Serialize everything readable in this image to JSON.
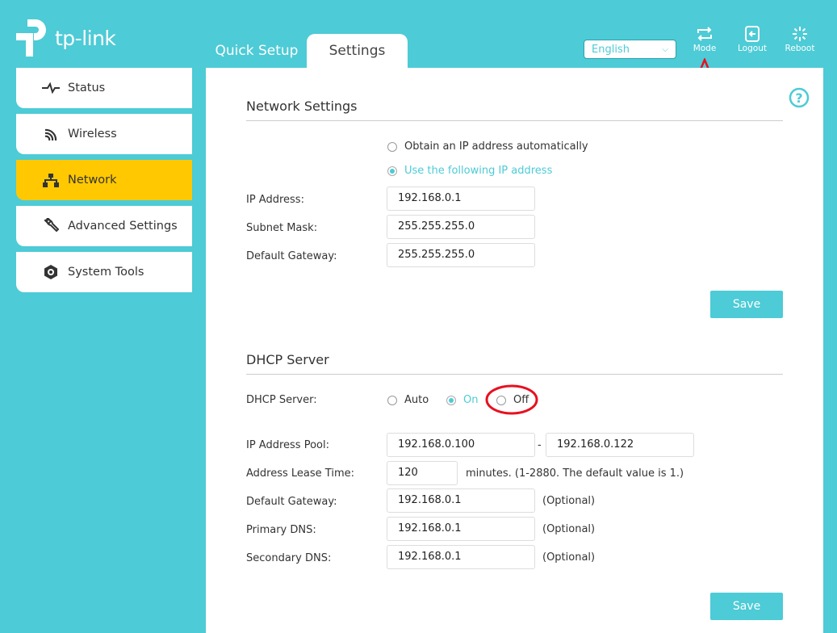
{
  "brand": {
    "name": "tp-link"
  },
  "tabs": [
    {
      "label": "Quick Setup"
    },
    {
      "label": "Settings",
      "active": true
    }
  ],
  "header": {
    "language": "English",
    "buttons": [
      {
        "label": "Mode",
        "icon": "mode-switch-icon"
      },
      {
        "label": "Logout",
        "icon": "logout-icon"
      },
      {
        "label": "Reboot",
        "icon": "reboot-icon"
      }
    ]
  },
  "sidebar": {
    "items": [
      {
        "label": "Status",
        "icon": "pulse-icon"
      },
      {
        "label": "Wireless",
        "icon": "wifi-icon"
      },
      {
        "label": "Network",
        "icon": "network-icon",
        "active": true
      },
      {
        "label": "Advanced Settings",
        "icon": "wrench-icon"
      },
      {
        "label": "System Tools",
        "icon": "gear-icon"
      }
    ]
  },
  "colors": {
    "accent": "#4dcbd6",
    "active_nav": "#ffc800",
    "annotation": "#e8101f"
  },
  "network": {
    "title": "Network Settings",
    "opt_auto": "Obtain an IP address automatically",
    "opt_manual": "Use the following IP address",
    "selected": "Use the following IP address",
    "fields": [
      {
        "label": "IP Address:",
        "value": "192.168.0.1"
      },
      {
        "label": "Subnet Mask:",
        "value": "255.255.255.0"
      },
      {
        "label": "Default Gateway:",
        "value": "255.255.255.0"
      }
    ],
    "save": "Save"
  },
  "dhcp": {
    "title": "DHCP Server",
    "server_label": "DHCP Server:",
    "options": [
      "Auto",
      "On",
      "Off"
    ],
    "selected": "On",
    "pool_label": "IP Address Pool:",
    "pool_start": "192.168.0.100",
    "pool_sep": "-",
    "pool_end": "192.168.0.122",
    "lease_label": "Address Lease Time:",
    "lease_value": "120",
    "lease_note": "minutes. (1-2880. The default value is 1.)",
    "fields": [
      {
        "label": "Default Gateway:",
        "value": "192.168.0.1",
        "note": "(Optional)"
      },
      {
        "label": "Primary DNS:",
        "value": "192.168.0.1",
        "note": "(Optional)"
      },
      {
        "label": "Secondary DNS:",
        "value": "192.168.0.1",
        "note": "(Optional)"
      }
    ],
    "save": "Save"
  }
}
